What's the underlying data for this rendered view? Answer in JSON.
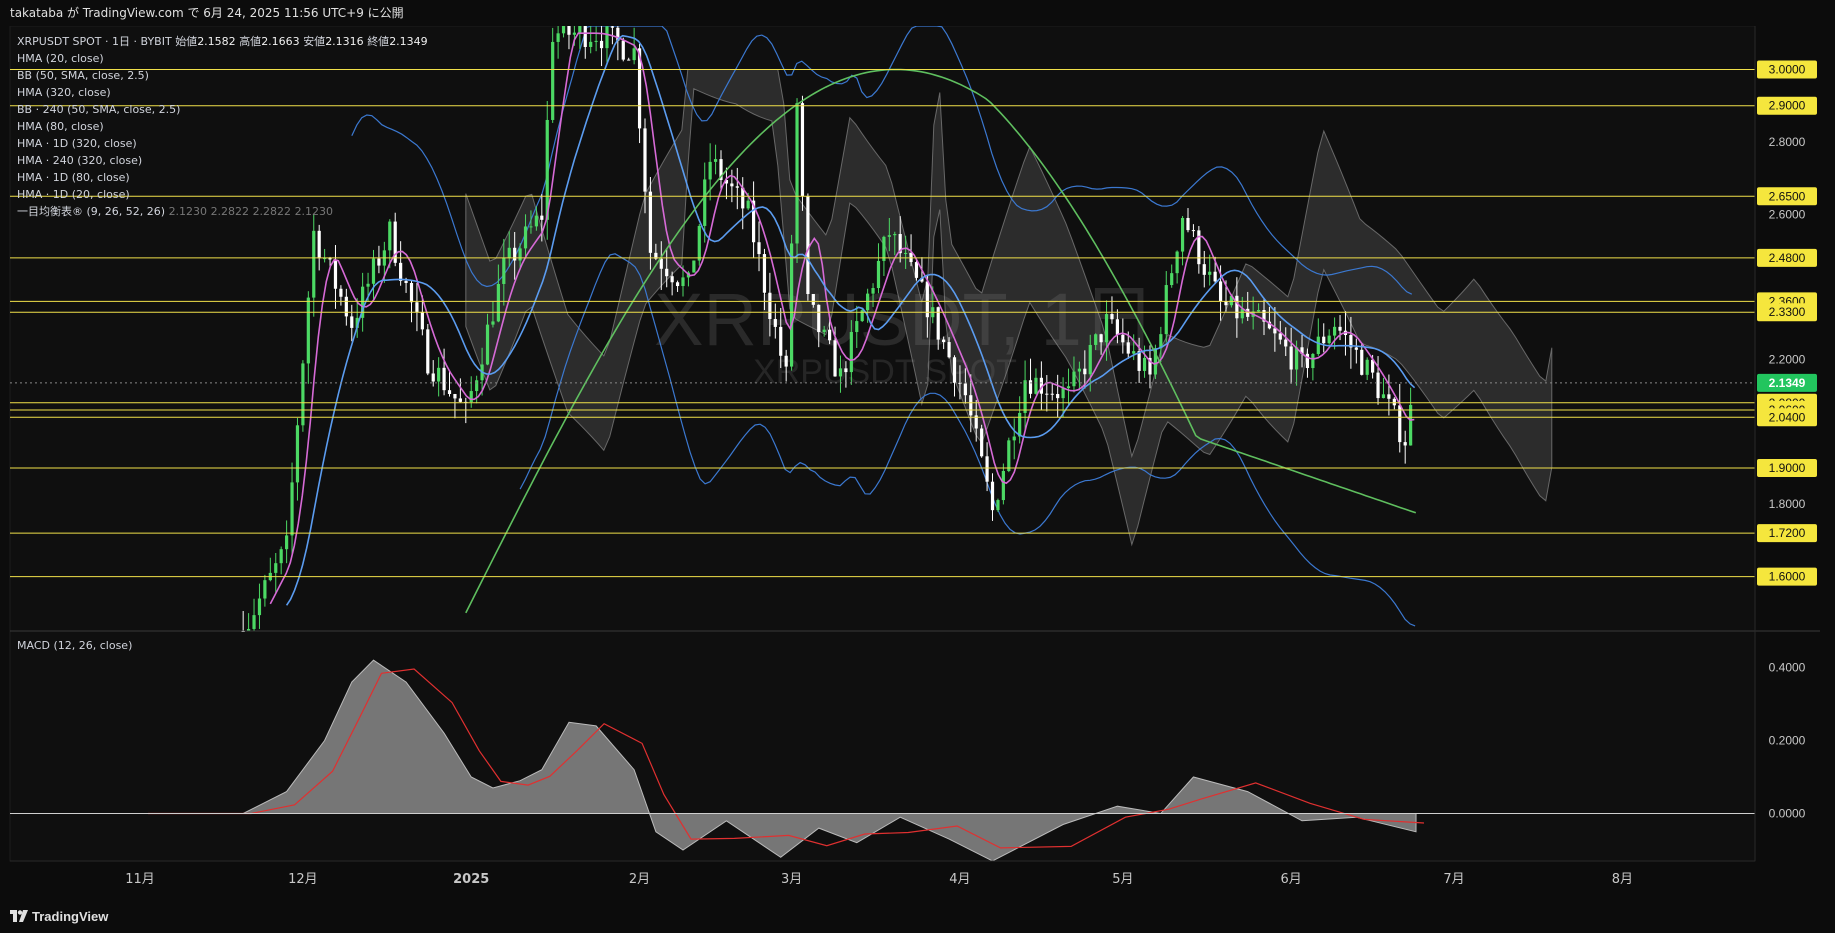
{
  "header": {
    "title": "takataba が TradingView.com で 6月 24, 2025 11:56 UTC+9 に公開"
  },
  "legend": {
    "symbol": "XRPUSDT SPOT · 1日 · BYBIT",
    "open_label": "始値",
    "open": "2.1582",
    "high_label": "高値",
    "high": "2.1663",
    "low_label": "安値",
    "low": "2.1316",
    "close_label": "終値",
    "close": "2.1349",
    "indicators": [
      "HMA (20, close)",
      "BB (50, SMA, close, 2.5)",
      "HMA (320, close)",
      "BB · 240 (50, SMA, close, 2.5)",
      "HMA (80, close)",
      "HMA · 1D (320, close)",
      "HMA · 240 (320, close)",
      "HMA · 1D (80, close)",
      "HMA · 1D (20, close)"
    ],
    "ichimoku": "一目均衡表® (9, 26, 52, 26)",
    "ichimoku_values": [
      "2.1230",
      "2.2822",
      "2.2822",
      "2.1230"
    ]
  },
  "watermark": {
    "main": "XRPUSDT, 1日",
    "sub": "XRPUSDT SPOT"
  },
  "macd_label": "MACD (12, 26, close)",
  "footer": {
    "brand": "TradingView"
  },
  "colors": {
    "background": "#0c0c0c",
    "up_candle": "#4cd964",
    "down_candle": "#ffffff",
    "level_line": "#f0e04a",
    "label_bg": "#f5e63d",
    "price_label_bg": "#22c55e",
    "hma20": "#d66ad6",
    "hma80": "#5b9cf0",
    "hma320": "#5fbf5f",
    "bb": "#3b78d0",
    "cloud": "#7a7a7a",
    "macd_fill": "#9a9a9a",
    "signal": "#e03030"
  },
  "chart_data": [
    {
      "type": "candlestick",
      "title": "XRPUSDT, 1日",
      "current_price": "2.1349",
      "y_axis_ticks": [
        "2.8000",
        "2.6000",
        "2.2000",
        "1.8000"
      ],
      "x_axis_ticks": [
        "11月",
        "12月",
        "2025",
        "2月",
        "3月",
        "4月",
        "5月",
        "6月",
        "7月",
        "8月"
      ],
      "ylim": [
        1.45,
        3.12
      ],
      "horizontal_levels": [
        "3.0000",
        "2.9000",
        "2.6500",
        "2.4800",
        "2.3600",
        "2.3300",
        "2.0800",
        "2.0600",
        "2.0400",
        "1.9000",
        "1.7200",
        "1.6000"
      ],
      "approx_close_path": [
        {
          "x": "2024-11-20",
          "y": 1.45
        },
        {
          "x": "2024-11-28",
          "y": 1.68
        },
        {
          "x": "2024-12-03",
          "y": 2.55
        },
        {
          "x": "2024-12-10",
          "y": 2.3
        },
        {
          "x": "2024-12-17",
          "y": 2.55
        },
        {
          "x": "2024-12-24",
          "y": 2.2
        },
        {
          "x": "2024-12-31",
          "y": 2.05
        },
        {
          "x": "2025-01-07",
          "y": 2.45
        },
        {
          "x": "2025-01-14",
          "y": 2.6
        },
        {
          "x": "2025-01-16",
          "y": 3.1
        },
        {
          "x": "2025-01-24",
          "y": 3.1
        },
        {
          "x": "2025-01-31",
          "y": 3.05
        },
        {
          "x": "2025-02-03",
          "y": 2.5
        },
        {
          "x": "2025-02-10",
          "y": 2.4
        },
        {
          "x": "2025-02-14",
          "y": 2.75
        },
        {
          "x": "2025-02-21",
          "y": 2.6
        },
        {
          "x": "2025-02-28",
          "y": 2.15
        },
        {
          "x": "2025-03-02",
          "y": 2.9
        },
        {
          "x": "2025-03-04",
          "y": 2.35
        },
        {
          "x": "2025-03-10",
          "y": 2.15
        },
        {
          "x": "2025-03-19",
          "y": 2.55
        },
        {
          "x": "2025-03-26",
          "y": 2.35
        },
        {
          "x": "2025-04-02",
          "y": 2.1
        },
        {
          "x": "2025-04-07",
          "y": 1.78
        },
        {
          "x": "2025-04-13",
          "y": 2.15
        },
        {
          "x": "2025-04-21",
          "y": 2.1
        },
        {
          "x": "2025-04-28",
          "y": 2.3
        },
        {
          "x": "2025-05-06",
          "y": 2.15
        },
        {
          "x": "2025-05-12",
          "y": 2.6
        },
        {
          "x": "2025-05-19",
          "y": 2.35
        },
        {
          "x": "2025-05-26",
          "y": 2.3
        },
        {
          "x": "2025-06-03",
          "y": 2.18
        },
        {
          "x": "2025-06-09",
          "y": 2.3
        },
        {
          "x": "2025-06-16",
          "y": 2.15
        },
        {
          "x": "2025-06-22",
          "y": 1.98
        },
        {
          "x": "2025-06-24",
          "y": 2.1349
        }
      ]
    },
    {
      "type": "area",
      "title": "MACD (12, 26, close)",
      "y_axis_ticks": [
        "0.4000",
        "0.2000",
        "0.0000"
      ],
      "ylim": [
        -0.13,
        0.5
      ],
      "approx_macd": [
        {
          "x": "2024-11-01",
          "y": 0.0
        },
        {
          "x": "2024-11-20",
          "y": 0.0
        },
        {
          "x": "2024-11-28",
          "y": 0.06
        },
        {
          "x": "2024-12-05",
          "y": 0.2
        },
        {
          "x": "2024-12-10",
          "y": 0.36
        },
        {
          "x": "2024-12-14",
          "y": 0.42
        },
        {
          "x": "2024-12-20",
          "y": 0.36
        },
        {
          "x": "2024-12-27",
          "y": 0.22
        },
        {
          "x": "2025-01-01",
          "y": 0.1
        },
        {
          "x": "2025-01-05",
          "y": 0.07
        },
        {
          "x": "2025-01-10",
          "y": 0.09
        },
        {
          "x": "2025-01-14",
          "y": 0.12
        },
        {
          "x": "2025-01-19",
          "y": 0.25
        },
        {
          "x": "2025-01-24",
          "y": 0.24
        },
        {
          "x": "2025-01-31",
          "y": 0.12
        },
        {
          "x": "2025-02-04",
          "y": -0.05
        },
        {
          "x": "2025-02-09",
          "y": -0.1
        },
        {
          "x": "2025-02-17",
          "y": -0.02
        },
        {
          "x": "2025-02-27",
          "y": -0.12
        },
        {
          "x": "2025-03-06",
          "y": -0.04
        },
        {
          "x": "2025-03-13",
          "y": -0.08
        },
        {
          "x": "2025-03-21",
          "y": -0.01
        },
        {
          "x": "2025-03-30",
          "y": -0.07
        },
        {
          "x": "2025-04-07",
          "y": -0.13
        },
        {
          "x": "2025-04-20",
          "y": -0.03
        },
        {
          "x": "2025-04-30",
          "y": 0.02
        },
        {
          "x": "2025-05-08",
          "y": 0.0
        },
        {
          "x": "2025-05-14",
          "y": 0.1
        },
        {
          "x": "2025-05-24",
          "y": 0.06
        },
        {
          "x": "2025-06-03",
          "y": -0.02
        },
        {
          "x": "2025-06-13",
          "y": -0.01
        },
        {
          "x": "2025-06-24",
          "y": -0.05
        }
      ]
    }
  ]
}
